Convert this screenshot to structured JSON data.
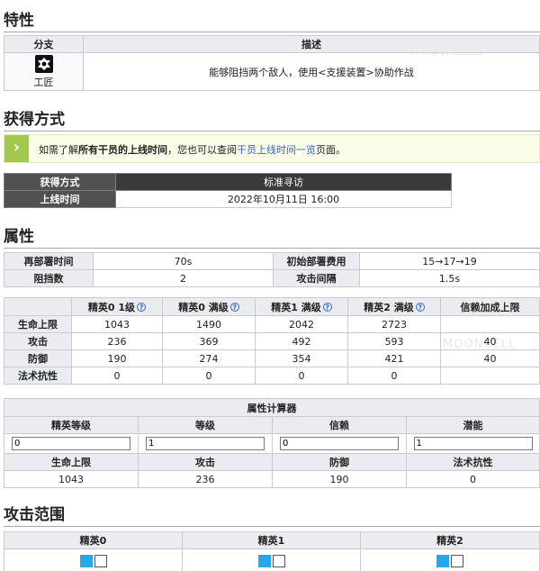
{
  "watermark": "MOONCELL",
  "trait": {
    "heading": "特性",
    "col_branch": "分支",
    "col_desc": "描述",
    "branch_name": "工匠",
    "branch_icon": "artificer-branch-icon",
    "description": "能够阻挡两个敌人，使用<支援装置>协助作战"
  },
  "obtain": {
    "heading": "获得方式",
    "notice_prefix": "如需了解",
    "notice_bold": "所有干员的上线时间",
    "notice_mid": "，您也可以查阅",
    "notice_link": "干员上线时间一览",
    "notice_suffix": "页面。",
    "rows": [
      {
        "label": "获得方式",
        "value": "标准寻访"
      },
      {
        "label": "上线时间",
        "value": "2022年10月11日 16:00"
      }
    ]
  },
  "attributes": {
    "heading": "属性",
    "basic": [
      {
        "l1": "再部署时间",
        "v1": "70s",
        "l2": "初始部署费用",
        "v2": "15→17→19"
      },
      {
        "l1": "阻挡数",
        "v1": "2",
        "l2": "攻击间隔",
        "v2": "1.5s"
      }
    ],
    "stat_headers": [
      "精英0 1级",
      "精英0 满级",
      "精英1 满级",
      "精英2 满级",
      "信赖加成上限"
    ],
    "stats": [
      {
        "label": "生命上限",
        "values": [
          "1043",
          "1490",
          "2042",
          "2723",
          ""
        ]
      },
      {
        "label": "攻击",
        "values": [
          "236",
          "369",
          "492",
          "593",
          "40"
        ]
      },
      {
        "label": "防御",
        "values": [
          "190",
          "274",
          "354",
          "421",
          "40"
        ]
      },
      {
        "label": "法术抗性",
        "values": [
          "0",
          "0",
          "0",
          "0",
          ""
        ]
      }
    ]
  },
  "calculator": {
    "title": "属性计算器",
    "inputs": [
      {
        "label": "精英等级",
        "value": "0"
      },
      {
        "label": "等级",
        "value": "1"
      },
      {
        "label": "信赖",
        "value": "0"
      },
      {
        "label": "潜能",
        "value": "1"
      }
    ],
    "outputs": [
      {
        "label": "生命上限",
        "value": "1043"
      },
      {
        "label": "攻击",
        "value": "236"
      },
      {
        "label": "防御",
        "value": "190"
      },
      {
        "label": "法术抗性",
        "value": "0"
      }
    ]
  },
  "range": {
    "heading": "攻击范围",
    "phases": [
      "精英0",
      "精英1",
      "精英2"
    ]
  },
  "colors": {
    "notice_green": "#a2c94d",
    "notice_bg": "#fbfde9",
    "dark_header": "#505050",
    "range_blue": "#27a7e7"
  }
}
